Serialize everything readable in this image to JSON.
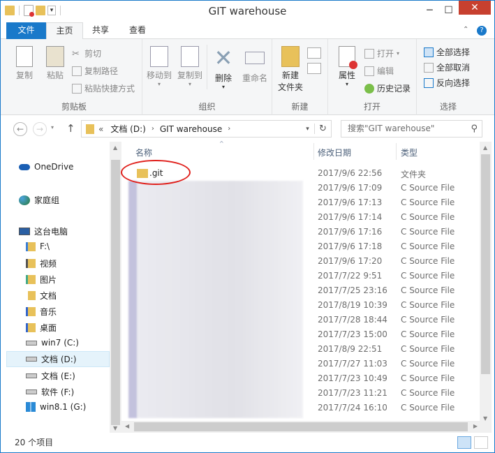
{
  "window": {
    "title": "GIT warehouse"
  },
  "ribbon_tabs": [
    {
      "label": "文件"
    },
    {
      "label": "主页"
    },
    {
      "label": "共享"
    },
    {
      "label": "查看"
    }
  ],
  "ribbon": {
    "clipboard": {
      "copy": "复制",
      "paste": "粘贴",
      "cut": "剪切",
      "copy_path": "复制路径",
      "paste_shortcut": "粘贴快捷方式",
      "group": "剪贴板"
    },
    "organize": {
      "move_to": "移动到",
      "copy_to": "复制到",
      "delete": "删除",
      "rename": "重命名",
      "group": "组织"
    },
    "new": {
      "new_folder_line1": "新建",
      "new_folder_line2": "文件夹",
      "group": "新建"
    },
    "open": {
      "properties": "属性",
      "open": "打开",
      "edit": "编辑",
      "history": "历史记录",
      "group": "打开"
    },
    "select": {
      "select_all": "全部选择",
      "select_none": "全部取消",
      "invert": "反向选择",
      "group": "选择"
    }
  },
  "address": {
    "prefix": "«",
    "crumbs": [
      {
        "label": "文档 (D:)"
      },
      {
        "label": "GIT warehouse"
      }
    ]
  },
  "search": {
    "placeholder": "搜索\"GIT warehouse\""
  },
  "nav": {
    "onedrive": "OneDrive",
    "homegroup": "家庭组",
    "thispc": "这台电脑",
    "items": [
      {
        "label": "F:\\"
      },
      {
        "label": "视频"
      },
      {
        "label": "图片"
      },
      {
        "label": "文档"
      },
      {
        "label": "音乐"
      },
      {
        "label": "桌面"
      },
      {
        "label": "win7 (C:)"
      },
      {
        "label": "文档 (D:)"
      },
      {
        "label": "文档 (E:)"
      },
      {
        "label": "软件 (F:)"
      },
      {
        "label": "win8.1 (G:)"
      }
    ]
  },
  "columns": {
    "name": "名称",
    "date": "修改日期",
    "type": "类型"
  },
  "files": [
    {
      "name": ".git",
      "date": "2017/9/6 22:56",
      "type": "文件夹"
    },
    {
      "name": "",
      "date": "2017/9/6 17:09",
      "type": "C Source File"
    },
    {
      "name": "",
      "date": "2017/9/6 17:13",
      "type": "C Source File"
    },
    {
      "name": "",
      "date": "2017/9/6 17:14",
      "type": "C Source File"
    },
    {
      "name": "",
      "date": "2017/9/6 17:16",
      "type": "C Source File"
    },
    {
      "name": "",
      "date": "2017/9/6 17:18",
      "type": "C Source File"
    },
    {
      "name": "",
      "date": "2017/9/6 17:20",
      "type": "C Source File"
    },
    {
      "name": "",
      "date": "2017/7/22 9:51",
      "type": "C Source File"
    },
    {
      "name": "",
      "date": "2017/7/25 23:16",
      "type": "C Source File"
    },
    {
      "name": "",
      "date": "2017/8/19 10:39",
      "type": "C Source File"
    },
    {
      "name": "",
      "date": "2017/7/28 18:44",
      "type": "C Source File"
    },
    {
      "name": "",
      "date": "2017/7/23 15:00",
      "type": "C Source File"
    },
    {
      "name": "",
      "date": "2017/8/9 22:51",
      "type": "C Source File"
    },
    {
      "name": "",
      "date": "2017/7/27 11:03",
      "type": "C Source File"
    },
    {
      "name": "",
      "date": "2017/7/23 10:49",
      "type": "C Source File"
    },
    {
      "name": "",
      "date": "2017/7/23 11:21",
      "type": "C Source File"
    },
    {
      "name": "",
      "date": "2017/7/24 16:10",
      "type": "C Source File"
    }
  ],
  "status": {
    "count": "20 个项目"
  },
  "colors": {
    "accent": "#1979ca",
    "annotation": "#e0201c",
    "folder": "#e8c15a"
  }
}
